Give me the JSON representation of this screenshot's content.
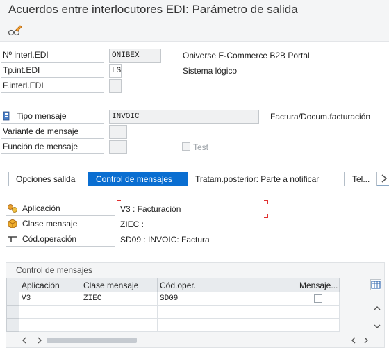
{
  "window": {
    "title": "Acuerdos entre interlocutores EDI: Parámetro de salida"
  },
  "toolbar": {
    "display_change_icon": "glasses-pencil-icon"
  },
  "header": {
    "partner_no": {
      "label": "Nº interl.EDI",
      "value": "ONIBEX",
      "description": "Oniverse E-Commerce B2B Portal"
    },
    "partner_type": {
      "label": "Tp.int.EDI",
      "value": "LS",
      "description": "Sistema lógico"
    },
    "partner_function": {
      "label": "F.interl.EDI",
      "value": ""
    },
    "message_type": {
      "label": "Tipo mensaje",
      "value": "INVOIC",
      "description": "Factura/Docum.facturación"
    },
    "message_variant": {
      "label": "Variante de mensaje",
      "value": ""
    },
    "message_function": {
      "label": "Función de mensaje",
      "value": ""
    },
    "test": {
      "label": "Test",
      "checked": false
    }
  },
  "tabs": [
    {
      "label": "Opciones salida",
      "active": false
    },
    {
      "label": "Control de mensajes",
      "active": true
    },
    {
      "label": "Tratam.posterior: Parte a notificar",
      "active": false
    },
    {
      "label": "Tel...",
      "active": false
    }
  ],
  "message_control": {
    "application": {
      "label": "Aplicación",
      "value": "V3 : Facturación"
    },
    "message_class": {
      "label": "Clase mensaje",
      "value": "ZIEC :"
    },
    "process_code": {
      "label": "Cód.operación",
      "value": "SD09 : INVOIC: Factura"
    }
  },
  "grid": {
    "title": "Control de mensajes",
    "columns": [
      "Aplicación",
      "Clase mensaje",
      "Cód.oper.",
      "Mensaje..."
    ],
    "rows": [
      {
        "app": "V3",
        "class": "ZIEC",
        "code": "SD09",
        "change": false
      }
    ]
  }
}
